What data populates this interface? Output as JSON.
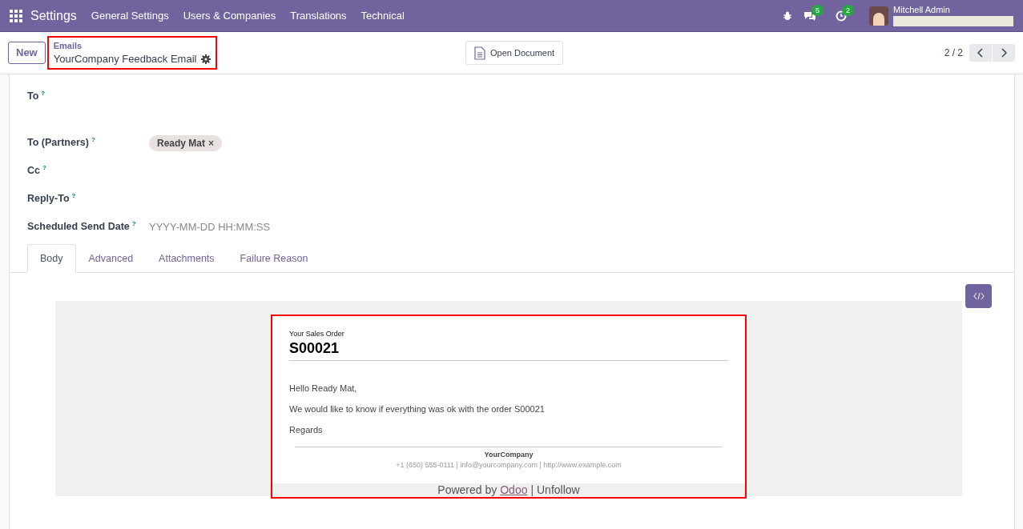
{
  "navbar": {
    "app_name": "Settings",
    "menu": [
      "General Settings",
      "Users & Companies",
      "Translations",
      "Technical"
    ],
    "chat_count": "5",
    "activity_count": "2",
    "user_name": "Mitchell Admin"
  },
  "control_panel": {
    "new_button": "New",
    "breadcrumb_parent": "Emails",
    "breadcrumb_current": "YourCompany Feedback Email",
    "open_document": "Open Document",
    "pager": "2 / 2"
  },
  "fields": [
    {
      "kind": "textarea",
      "label": "To",
      "help": "?"
    },
    {
      "kind": "tags",
      "label": "To (Partners)",
      "help": "?",
      "tags": [
        {
          "label": "Ready Mat",
          "remove": "×"
        }
      ]
    },
    {
      "kind": "empty",
      "label": "Cc",
      "help": "?"
    },
    {
      "kind": "empty",
      "label": "Reply-To",
      "help": "?"
    },
    {
      "kind": "input",
      "label": "Scheduled Send Date",
      "help": "?",
      "placeholder": "YYYY-MM-DD HH:MM:SS"
    }
  ],
  "tabs": [
    {
      "label": "Body",
      "selected": true
    },
    {
      "label": "Advanced",
      "selected": false
    },
    {
      "label": "Attachments",
      "selected": false
    },
    {
      "label": "Failure Reason",
      "selected": false
    }
  ],
  "email": {
    "header_label": "Your Sales Order",
    "order": "S00021",
    "paragraphs": [
      "Hello Ready Mat,",
      "We would like to know if everything was ok with the order S00021",
      "Regards"
    ],
    "company": "YourCompany",
    "contact": "+1 (650) 555-0111 | info@yourcompany.com | http://www.example.com",
    "powered_prefix": "Powered by",
    "powered_link": "Odoo",
    "powered_suffix": "| Unfollow"
  }
}
